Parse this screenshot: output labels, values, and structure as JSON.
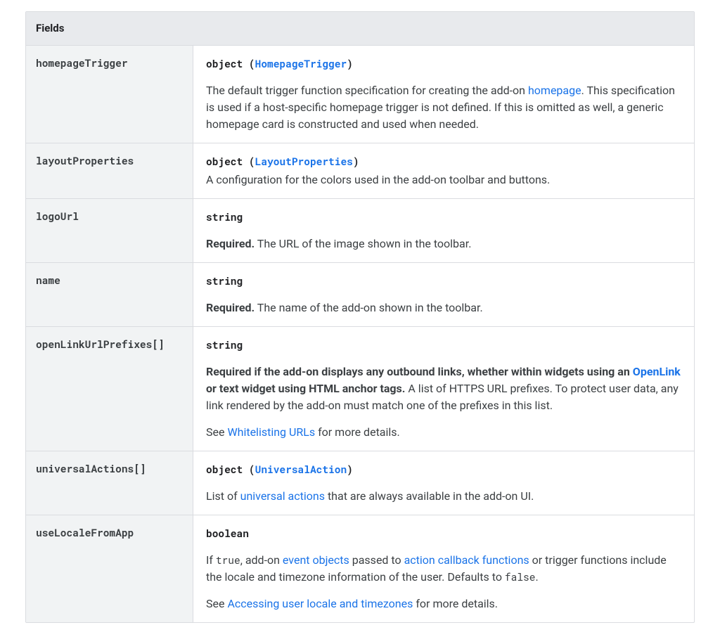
{
  "header": "Fields",
  "rows": {
    "r0": {
      "name": "homepageTrigger",
      "type_prefix": "object (",
      "type_link": "HomepageTrigger",
      "type_suffix": ")",
      "p1_a": "The default trigger function specification for creating the add-on ",
      "p1_link": "homepage",
      "p1_b": ". This specification is used if a host-specific homepage trigger is not defined. If this is omitted as well, a generic homepage card is constructed and used when needed."
    },
    "r1": {
      "name": "layoutProperties",
      "type_prefix": "object (",
      "type_link": "LayoutProperties",
      "type_suffix": ")",
      "p1": "A configuration for the colors used in the add-on toolbar and buttons."
    },
    "r2": {
      "name": "logoUrl",
      "type": "string",
      "req": "Required.",
      "p1": " The URL of the image shown in the toolbar."
    },
    "r3": {
      "name": "name",
      "type": "string",
      "req": "Required.",
      "p1": " The name of the add-on shown in the toolbar."
    },
    "r4": {
      "name": "openLinkUrlPrefixes[]",
      "type": "string",
      "boldA": "Required if the add-on displays any outbound links, whether within widgets using an ",
      "linkA": "OpenLink",
      "boldB": " or text widget using HTML anchor tags.",
      "tail": " A list of HTTPS URL prefixes. To protect user data, any link rendered by the add-on must match one of the prefixes in this list.",
      "see_a": "See ",
      "see_link": "Whitelisting URLs",
      "see_b": " for more details."
    },
    "r5": {
      "name": "universalActions[]",
      "type_prefix": "object (",
      "type_link": "UniversalAction",
      "type_suffix": ")",
      "p1_a": "List of ",
      "p1_link": "universal actions",
      "p1_b": " that are always available in the add-on UI."
    },
    "r6": {
      "name": "useLocaleFromApp",
      "type": "boolean",
      "p1_a": "If ",
      "code1": "true",
      "p1_b": ", add-on ",
      "link1": "event objects",
      "p1_c": " passed to ",
      "link2": "action callback functions",
      "p1_d": " or trigger functions include the locale and timezone information of the user. Defaults to ",
      "code2": "false",
      "p1_e": ".",
      "see_a": "See ",
      "see_link": "Accessing user locale and timezones",
      "see_b": " for more details."
    }
  }
}
